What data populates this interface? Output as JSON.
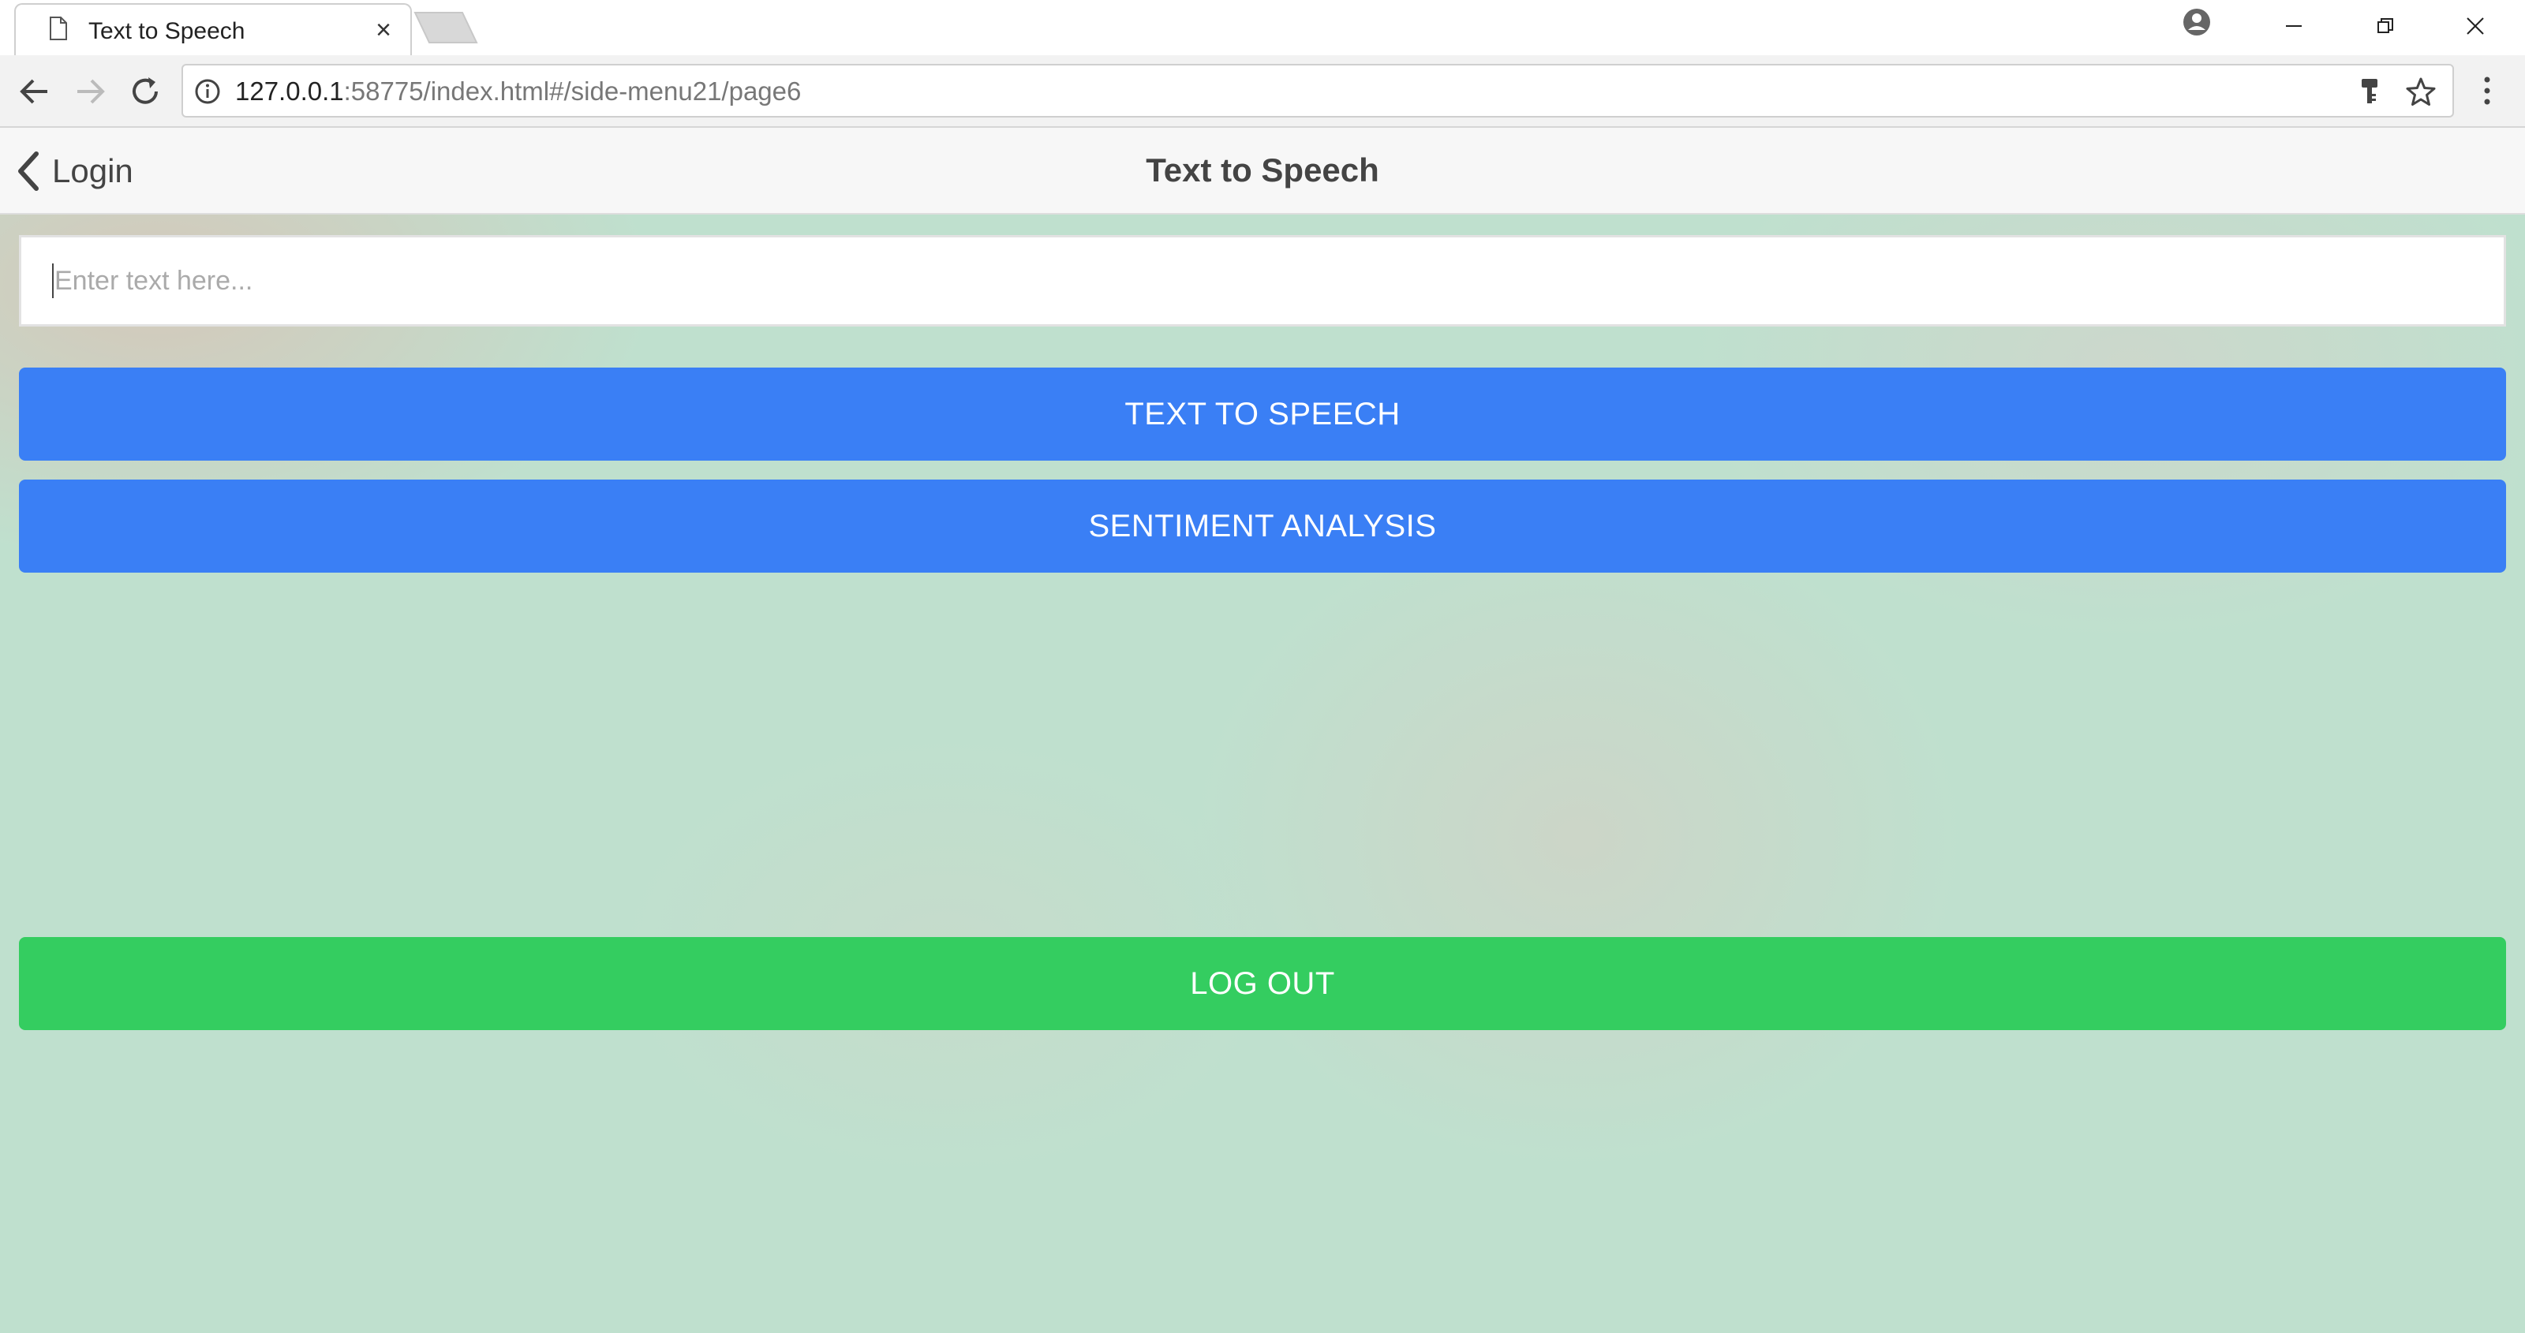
{
  "browser": {
    "tab_title": "Text to Speech",
    "tab_close": "×",
    "url_host": "127.0.0.1",
    "url_rest": ":58775/index.html#/side-menu21/page6"
  },
  "navbar": {
    "back_label": "Login",
    "title": "Text to Speech"
  },
  "form": {
    "text_placeholder": "Enter text here...",
    "text_value": ""
  },
  "buttons": {
    "tts_label": "TEXT TO SPEECH",
    "sentiment_label": "SENTIMENT ANALYSIS",
    "logout_label": "LOG OUT"
  },
  "colors": {
    "primary_button": "#3a7ff5",
    "logout_button": "#34cd60"
  }
}
